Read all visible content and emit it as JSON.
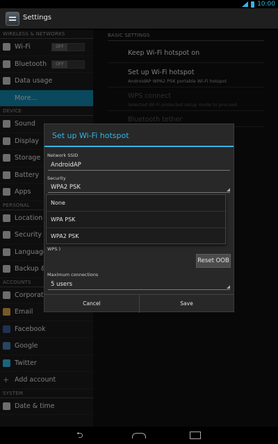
{
  "status": {
    "time": "10:00"
  },
  "app": {
    "title": "Settings"
  },
  "sidebar": {
    "sections": [
      {
        "label": "WIRELESS & NETWORKS"
      },
      {
        "label": "DEVICE"
      },
      {
        "label": "PERSONAL"
      },
      {
        "label": "ACCOUNTS"
      },
      {
        "label": "SYSTEM"
      }
    ],
    "items": [
      {
        "label": "Wi-Fi",
        "toggle": "OFF"
      },
      {
        "label": "Bluetooth",
        "toggle": "OFF"
      },
      {
        "label": "Data usage"
      },
      {
        "label": "More..."
      },
      {
        "label": "Sound"
      },
      {
        "label": "Display"
      },
      {
        "label": "Storage"
      },
      {
        "label": "Battery"
      },
      {
        "label": "Apps"
      },
      {
        "label": "Location a"
      },
      {
        "label": "Security"
      },
      {
        "label": "Language"
      },
      {
        "label": "Backup & r"
      },
      {
        "label": "Corporate"
      },
      {
        "label": "Email"
      },
      {
        "label": "Facebook"
      },
      {
        "label": "Google"
      },
      {
        "label": "Twitter"
      },
      {
        "label": "Add account"
      },
      {
        "label": "Date & time"
      }
    ]
  },
  "main": {
    "section": "BASIC SETTINGS",
    "items": [
      {
        "title": "Keep Wi-Fi hotspot on",
        "subtitle": ""
      },
      {
        "title": "Set up Wi-Fi hotspot",
        "subtitle": "AndroidAP WPA2 PSK portable Wi-Fi hotspot"
      },
      {
        "title": "WPS connect",
        "subtitle": "Selected Wi-Fi protected setup mode to proceed"
      },
      {
        "title": "Bluetooth tether",
        "subtitle": ""
      }
    ]
  },
  "dialog": {
    "title": "Set up Wi-Fi hotspot",
    "ssid_label": "Network SSID",
    "ssid_value": "AndroidAP",
    "security_label": "Security",
    "security_value": "WPA2 PSK",
    "wps_partial": "WPS )",
    "reset_label": "Reset OOB",
    "max_label": "Maximum connections",
    "max_value": "5 users",
    "cancel_label": "Cancel",
    "save_label": "Save"
  },
  "dropdown": {
    "options": [
      "None",
      "WPA PSK",
      "WPA2 PSK"
    ]
  }
}
